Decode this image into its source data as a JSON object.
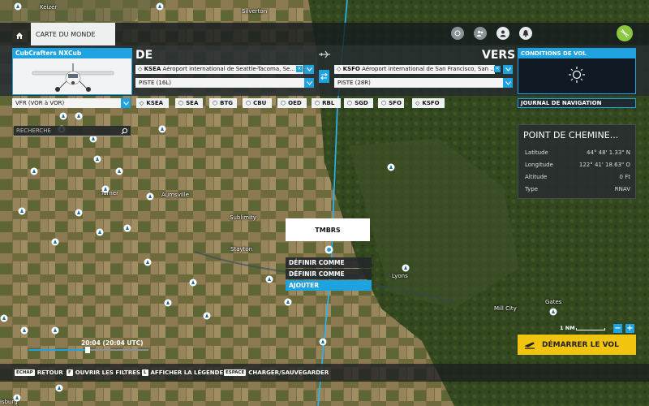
{
  "colors": {
    "accent": "#1fa3e0",
    "start_button": "#f1c40f",
    "avatar_green": "#8dc63f"
  },
  "top_bar": {
    "world_map_tab": "CARTE DU MONDE"
  },
  "aircraft": {
    "name": "CubCrafters NXCub"
  },
  "departure": {
    "label": "DE",
    "airport_code": "KSEA",
    "airport_name": "Aéroport international de Seattle-Tacoma, Se...",
    "runway": "PISTE (16L)"
  },
  "arrival": {
    "label": "VERS",
    "airport_code": "KSFO",
    "airport_name": "Aéroport international de San Francisco, San ...",
    "runway": "PISTE (28R)"
  },
  "weather": {
    "title": "CONDITIONS DE VOL",
    "icon": "sun-icon"
  },
  "nav_log": {
    "label": "JOURNAL DE NAVIGATION"
  },
  "flight_type": {
    "value": "VFR (VOR à VOR)"
  },
  "waypoints": [
    "KSEA",
    "SEA",
    "BTG",
    "CBU",
    "OED",
    "RBL",
    "SGD",
    "SFO",
    "KSFO"
  ],
  "search": {
    "placeholder": "RECHERCHE"
  },
  "waypoint_panel": {
    "title": "POINT DE CHEMINE...",
    "rows": [
      {
        "label": "Latitude",
        "value": "44° 48' 1.33\" N"
      },
      {
        "label": "Longitude",
        "value": "122° 41' 18.63\" O"
      },
      {
        "label": "Altitude",
        "value": "0 Ft"
      },
      {
        "label": "Type",
        "value": "RNAV"
      }
    ]
  },
  "context_menu": {
    "title": "TMBRS",
    "items": [
      "DÉFINIR COMME DÉPART",
      "DÉFINIR COMME ARRIVÉE",
      "AJOUTER"
    ],
    "highlighted_index": 2
  },
  "map_labels": {
    "keizer": "Keizer",
    "silverton": "Silverton",
    "aumsville": "Aumsville",
    "sublimity": "Sublimity",
    "stayton": "Stayton",
    "lyons": "Lyons",
    "gates": "Gates",
    "mill_city": "Mill City",
    "turner": "Turner",
    "harrisburg": "isburg"
  },
  "time": {
    "label": "20:04 (20:04 UTC)",
    "progress": 0.49
  },
  "scale": {
    "label": "1 NM"
  },
  "zoom": {
    "minus": "−",
    "plus": "+"
  },
  "start_flight": {
    "label": "DÉMARRER LE VOL"
  },
  "bottom_hints": [
    {
      "key": "ECHAP",
      "label": "RETOUR"
    },
    {
      "key": "F",
      "label": "OUVRIR LES FILTRES"
    },
    {
      "key": "L",
      "label": "AFFICHER LA LÉGENDE"
    },
    {
      "key": "ESPACE",
      "label": "CHARGER/SAUVEGARDER"
    }
  ]
}
